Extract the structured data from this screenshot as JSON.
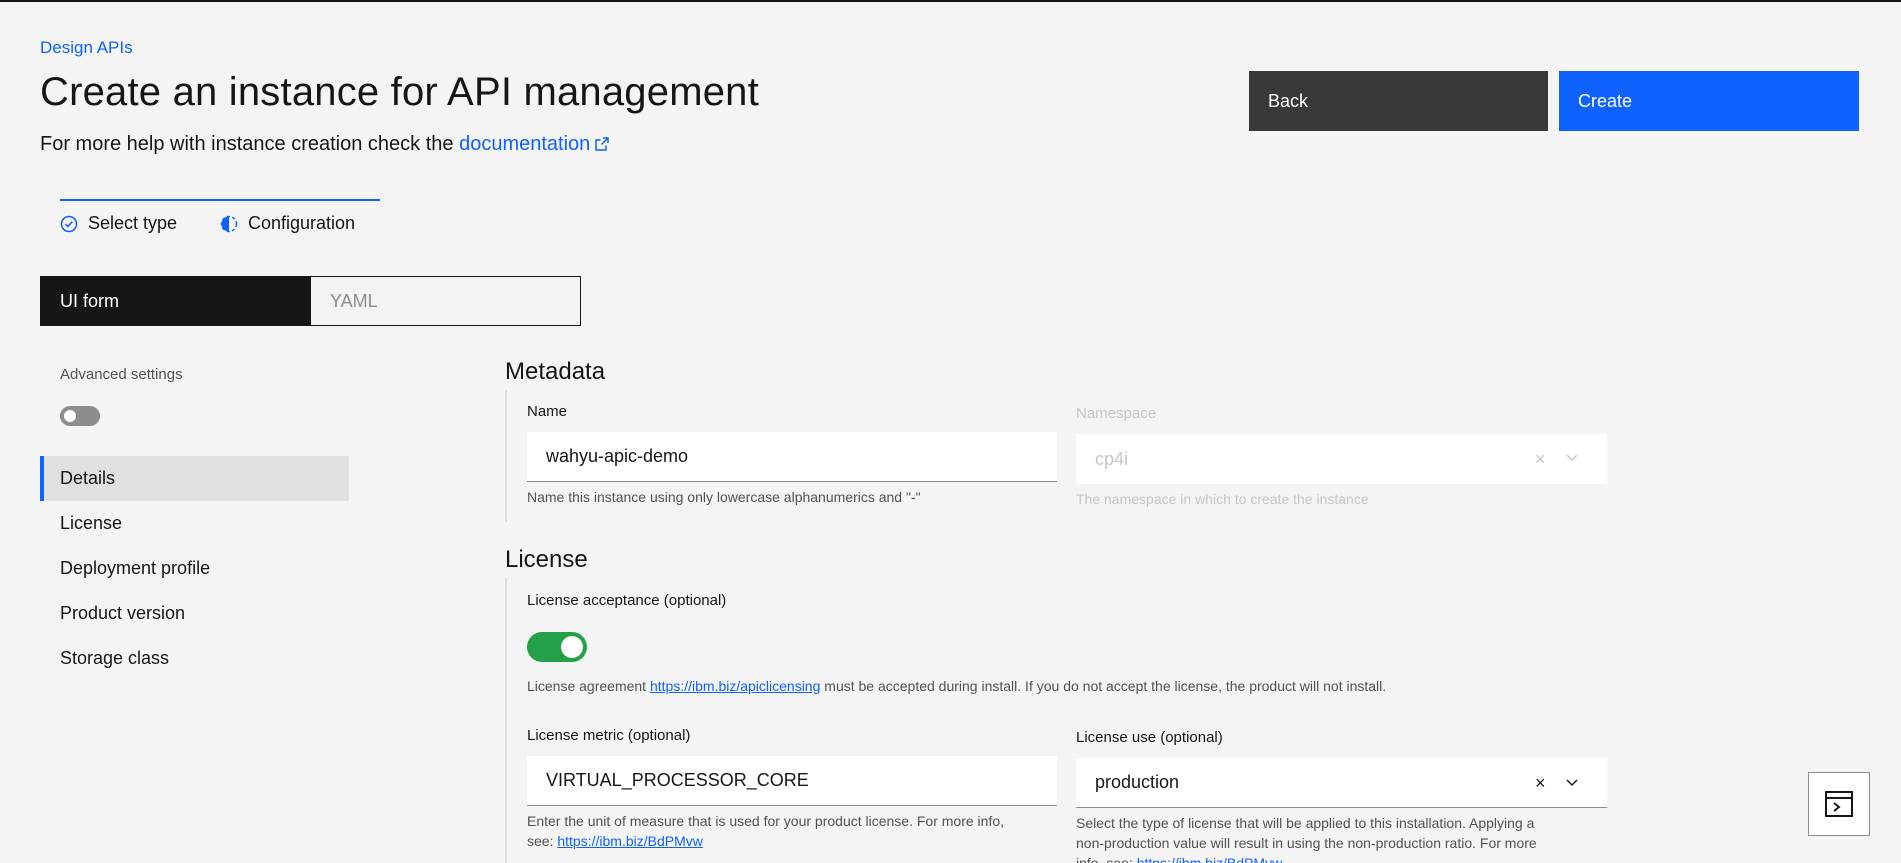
{
  "breadcrumb": "Design APIs",
  "page_title": "Create an instance for API management",
  "subtitle": {
    "text": "For more help with instance creation check the ",
    "link": "documentation"
  },
  "actions": {
    "back_label": "Back",
    "create_label": "Create"
  },
  "progress": {
    "steps": [
      {
        "label": "Select type",
        "state": "complete"
      },
      {
        "label": "Configuration",
        "state": "current"
      }
    ]
  },
  "view_switcher": {
    "active": "UI form",
    "inactive": "YAML"
  },
  "advanced_settings": {
    "label": "Advanced settings",
    "enabled": false
  },
  "nav": {
    "items": [
      {
        "label": "Details",
        "active": true
      },
      {
        "label": "License",
        "active": false
      },
      {
        "label": "Deployment profile",
        "active": false
      },
      {
        "label": "Product version",
        "active": false
      },
      {
        "label": "Storage class",
        "active": false
      }
    ]
  },
  "metadata": {
    "title": "Metadata",
    "name": {
      "label": "Name",
      "value": "wahyu-apic-demo",
      "helper": "Name this instance using only lowercase alphanumerics and \"-\""
    },
    "namespace": {
      "label": "Namespace",
      "value": "cp4i",
      "helper": "The namespace in which to create the instance",
      "disabled": true
    }
  },
  "license": {
    "title": "License",
    "acceptance": {
      "label": "License acceptance (optional)",
      "enabled": true,
      "helper_pre": "License agreement ",
      "helper_link": "https://ibm.biz/apiclicensing",
      "helper_post": " must be accepted during install. If you do not accept the license, the product will not install."
    },
    "metric": {
      "label": "License metric (optional)",
      "value": "VIRTUAL_PROCESSOR_CORE",
      "helper_line1": "Enter the unit of measure that is used for your product license. For more info,",
      "helper_see": "see: ",
      "helper_link": "https://ibm.biz/BdPMvw"
    },
    "use": {
      "label": "License use (optional)",
      "value": "production",
      "helper_line1": "Select the type of license that will be applied to this installation. Applying a",
      "helper_line2": "non-production value will result in using the non-production ratio. For more",
      "helper_line3": "info, see: ",
      "helper_link": "https://ibm.biz/BdPMvw"
    }
  },
  "colors": {
    "primary": "#0f62fe",
    "toggle_on": "#24a148",
    "toggle_off": "#8d8d8d",
    "dark_button": "#393939"
  },
  "icons": [
    "external-link-icon",
    "checkmark-outline-icon",
    "incomplete-icon",
    "close-icon",
    "chevron-down-icon",
    "terminal-panel-icon"
  ]
}
